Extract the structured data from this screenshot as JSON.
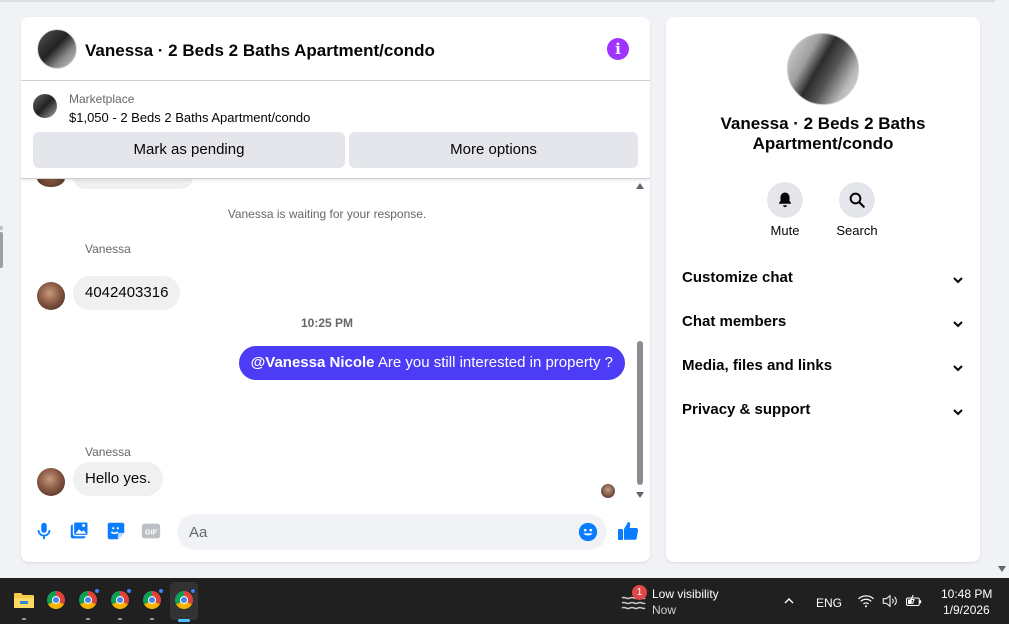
{
  "chat": {
    "title": "Vanessa · 2 Beds 2 Baths Apartment/condo",
    "marketplace_label": "Marketplace",
    "listing": "$1,050 - 2 Beds 2 Baths Apartment/condo",
    "mark_pending_label": "Mark as pending",
    "more_options_label": "More options",
    "system_message": "Vanessa is waiting for your response.",
    "messages": [
      {
        "sender": "Vanessa",
        "text": "4042403316"
      },
      {
        "sender": "Vanessa",
        "text": "Hello yes."
      }
    ],
    "timestamp": "10:25 PM",
    "outgoing": {
      "mention": "@Vanessa Nicole",
      "text": " Are you still interested in property ?"
    },
    "composer_placeholder": "Aa"
  },
  "info_panel": {
    "title": "Vanessa · 2 Beds 2 Baths Apartment/condo",
    "mute_label": "Mute",
    "search_label": "Search",
    "sections": [
      "Customize chat",
      "Chat members",
      "Media, files and links",
      "Privacy & support"
    ]
  },
  "taskbar": {
    "weather_badge": "1",
    "weather_title": "Low visibility",
    "weather_sub": "Now",
    "language": "ENG",
    "time": "10:48 PM",
    "date": "1/9/2026"
  },
  "colors": {
    "accent": "#a033ff",
    "outgoing_bubble": "#4d3cf5",
    "messenger_blue": "#0a7cff"
  }
}
